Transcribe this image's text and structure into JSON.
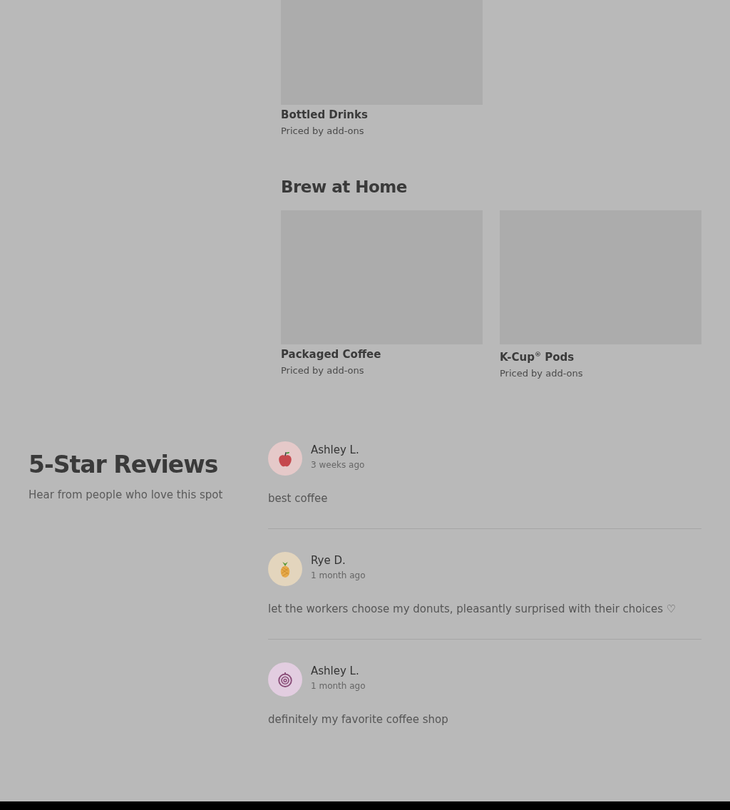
{
  "menu_sections": [
    {
      "items": [
        {
          "name": "Bottled Drinks",
          "price": "Priced by add-ons"
        }
      ]
    },
    {
      "title": "Brew at Home",
      "items": [
        {
          "name": "Packaged Coffee",
          "price": "Priced by add-ons"
        },
        {
          "name": "K-Cup$^{®}$ Pods",
          "price": "Priced by add-ons"
        }
      ]
    }
  ],
  "reviews_section": {
    "title": "5-Star Reviews",
    "subtitle": "Hear from people who love this spot",
    "reviews": [
      {
        "author": "Ashley L.",
        "time": "3 weeks ago",
        "text": "best coffee",
        "avatar": {
          "kind": "apple"
        }
      },
      {
        "author": "Rye D.",
        "time": "1 month ago",
        "text": "let the workers choose my donuts, pleasantly surprised with their choices ♡",
        "avatar": {
          "kind": "pineapple"
        }
      },
      {
        "author": "Ashley L.",
        "time": "1 month ago",
        "text": "definitely my favorite coffee shop",
        "avatar": {
          "kind": "onion"
        }
      }
    ]
  }
}
